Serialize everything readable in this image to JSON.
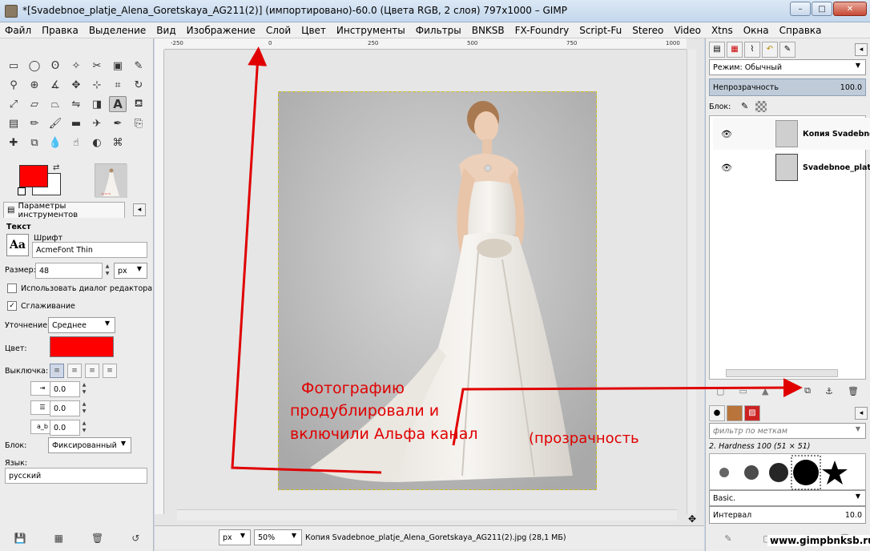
{
  "window": {
    "title": "*[Svadebnoe_platje_Alena_Goretskaya_AG211(2)] (импортировано)-60.0 (Цвета RGB, 2 слоя) 797x1000 – GIMP",
    "app_icon": "gimp-icon",
    "buttons": {
      "minimize": "–",
      "maximize": "□",
      "close": "✕"
    }
  },
  "menu": [
    "Файл",
    "Правка",
    "Выделение",
    "Вид",
    "Изображение",
    "Слой",
    "Цвет",
    "Инструменты",
    "Фильтры",
    "BNKSB",
    "FX-Foundry",
    "Script-Fu",
    "Stereo",
    "Video",
    "Xtns",
    "Окна",
    "Справка"
  ],
  "toolbox": {
    "fg_color": "#ff0000",
    "bg_color": "#ffffff",
    "tools": [
      {
        "name": "rect-select",
        "glyph": "▭"
      },
      {
        "name": "ellipse-select",
        "glyph": "◯"
      },
      {
        "name": "lasso",
        "glyph": "ʘ"
      },
      {
        "name": "fuzzy-select",
        "glyph": "✧"
      },
      {
        "name": "scissors",
        "glyph": "✂"
      },
      {
        "name": "foreground-select",
        "glyph": "▣"
      },
      {
        "name": "paths",
        "glyph": "✎"
      },
      {
        "name": "color-picker",
        "glyph": "⚲"
      },
      {
        "name": "zoom",
        "glyph": "⊕"
      },
      {
        "name": "measure",
        "glyph": "∡"
      },
      {
        "name": "move",
        "glyph": "✥"
      },
      {
        "name": "align",
        "glyph": "⊹"
      },
      {
        "name": "crop",
        "glyph": "⌗"
      },
      {
        "name": "rotate",
        "glyph": "↻"
      },
      {
        "name": "scale",
        "glyph": "⤢"
      },
      {
        "name": "shear",
        "glyph": "▱"
      },
      {
        "name": "perspective",
        "glyph": "⏢"
      },
      {
        "name": "flip",
        "glyph": "⇋"
      },
      {
        "name": "cage",
        "glyph": "◨"
      },
      {
        "name": "text",
        "glyph": "A",
        "active": true
      },
      {
        "name": "bucket-fill",
        "glyph": "⛾"
      },
      {
        "name": "blend",
        "glyph": "▤"
      },
      {
        "name": "pencil",
        "glyph": "✏"
      },
      {
        "name": "paintbrush",
        "glyph": "🖌"
      },
      {
        "name": "eraser",
        "glyph": "▬"
      },
      {
        "name": "airbrush",
        "glyph": "✈"
      },
      {
        "name": "ink",
        "glyph": "✒"
      },
      {
        "name": "clone",
        "glyph": "⎘"
      },
      {
        "name": "heal",
        "glyph": "✚"
      },
      {
        "name": "perspective-clone",
        "glyph": "⧉"
      },
      {
        "name": "blur",
        "glyph": "💧"
      },
      {
        "name": "smudge",
        "glyph": "☝"
      },
      {
        "name": "dodge-burn",
        "glyph": "◐"
      },
      {
        "name": "warp",
        "glyph": "⌘"
      }
    ],
    "options_tab_label": "Параметры инструментов",
    "section_title": "Текст",
    "font_label": "Шрифт",
    "font_preview": "Aa",
    "font_value": "AcmeFont Thin",
    "size_label": "Размер:",
    "size_value": "48",
    "size_unit": "px",
    "use_editor_label": "Использовать диалог редактора",
    "antialias_label": "Сглаживание",
    "hinting_label": "Уточнение:",
    "hinting_value": "Среднее",
    "color_label": "Цвет:",
    "text_color": "#ff0000",
    "justify_label": "Выключка:",
    "indent_value": "0.0",
    "line_spacing_value": "0.0",
    "letter_spacing_value": "0.0",
    "box_label": "Блок:",
    "box_value": "Фиксированный",
    "language_label": "Язык:",
    "language_value": "русский"
  },
  "canvas": {
    "ruler_ticks": [
      "-250",
      "0",
      "250",
      "500",
      "750",
      "1000"
    ],
    "unit": "px",
    "zoom": "50%",
    "status_text": "Копия Svadebnoe_platje_Alena_Goretskaya_AG211(2).jpg (28,1 МБ)"
  },
  "layers": {
    "mode_label": "Режим: Обычный",
    "opacity_label": "Непрозрачность",
    "opacity_value": "100.0",
    "lock_label": "Блок:",
    "items": [
      {
        "name": "Копия Svadebnoe",
        "visible": true
      },
      {
        "name": "Svadebnoe_platje_",
        "visible": true
      }
    ]
  },
  "brushes": {
    "filter_placeholder": "фильтр по меткам",
    "brush_name": "2. Hardness 100 (51 × 51)",
    "preset_value": "Basic.",
    "interval_label": "Интервал",
    "interval_value": "10.0"
  },
  "annotation": {
    "line1": "Фотографию",
    "line2": "продублировали и",
    "line3": "включили Альфа канал",
    "line4": "(прозрачность",
    "color": "#e00000"
  },
  "watermark": "www.gimpbnksb.ru"
}
